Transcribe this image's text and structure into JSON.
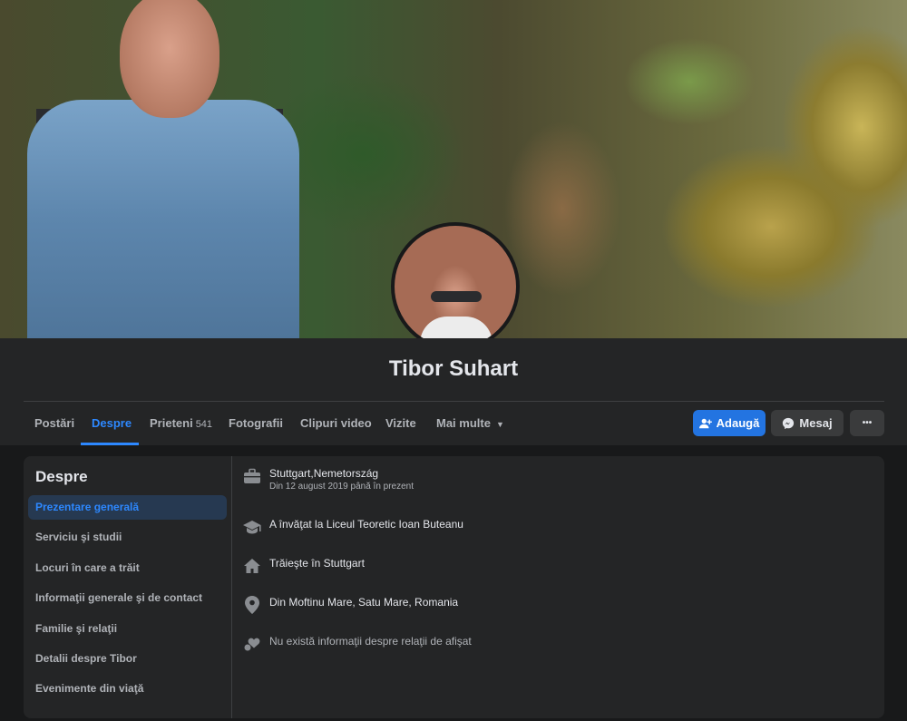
{
  "profile": {
    "name": "Tibor Suhart"
  },
  "tabs": [
    {
      "label": "Postări"
    },
    {
      "label": "Despre"
    },
    {
      "label": "Prieteni",
      "count": "541"
    },
    {
      "label": "Fotografii"
    },
    {
      "label": "Clipuri video"
    },
    {
      "label": "Vizite"
    },
    {
      "label": "Mai multe"
    }
  ],
  "actions": {
    "add": "Adaugă",
    "message": "Mesaj",
    "more": "•••"
  },
  "about": {
    "title": "Despre",
    "nav": [
      "Prezentare generală",
      "Serviciu şi studii",
      "Locuri în care a trăit",
      "Informaţii generale şi de contact",
      "Familie şi relaţii",
      "Detalii despre Tibor",
      "Evenimente din viaţă"
    ],
    "work": {
      "title": "Stuttgart,Nemetország",
      "sub": "Din 12 august 2019 până în prezent"
    },
    "education": "A învăţat la Liceul Teoretic Ioan Buteanu",
    "lives": "Trăieşte în Stuttgart",
    "from": "Din Moftinu Mare, Satu Mare, Romania",
    "relationship": "Nu există informaţii despre relaţii de afişat"
  },
  "colors": {
    "accent": "#2d88ff",
    "button_primary": "#2374e1",
    "background": "#18191a",
    "card": "#242526"
  },
  "icons": [
    "briefcase-icon",
    "graduation-cap-icon",
    "home-icon",
    "location-pin-icon",
    "heart-icon",
    "add-friend-icon",
    "messenger-icon"
  ]
}
